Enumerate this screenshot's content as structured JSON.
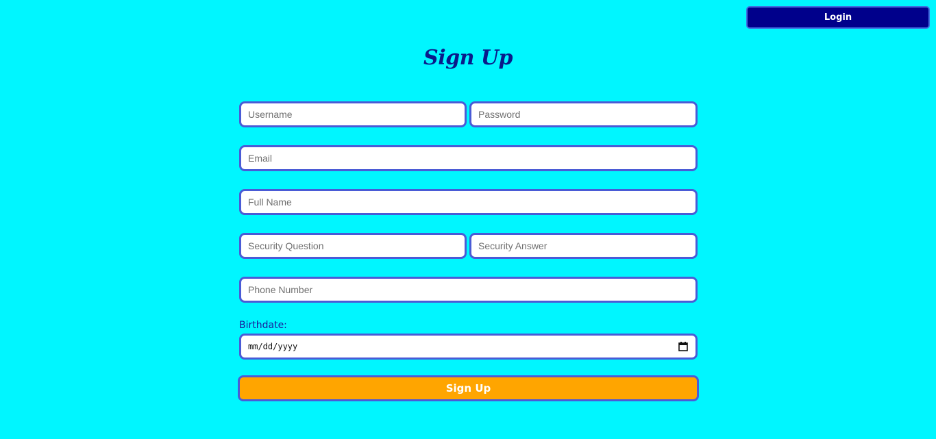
{
  "header": {
    "login_label": "Login"
  },
  "title": "Sign Up",
  "form": {
    "username_placeholder": "Username",
    "password_placeholder": "Password",
    "email_placeholder": "Email",
    "fullname_placeholder": "Full Name",
    "security_question_placeholder": "Security Question",
    "security_answer_placeholder": "Security Answer",
    "phone_placeholder": "Phone Number",
    "birthdate_label": "Birthdate:",
    "birthdate_format": "mm/dd/yyyy",
    "submit_label": "Sign Up"
  },
  "icons": {
    "calendar": "calendar-icon"
  },
  "colors": {
    "background": "#00f6ff",
    "login_button": "#00008b",
    "title": "#0a1a8a",
    "field_border": "#4a5bd6",
    "submit_button": "#ffa500"
  }
}
